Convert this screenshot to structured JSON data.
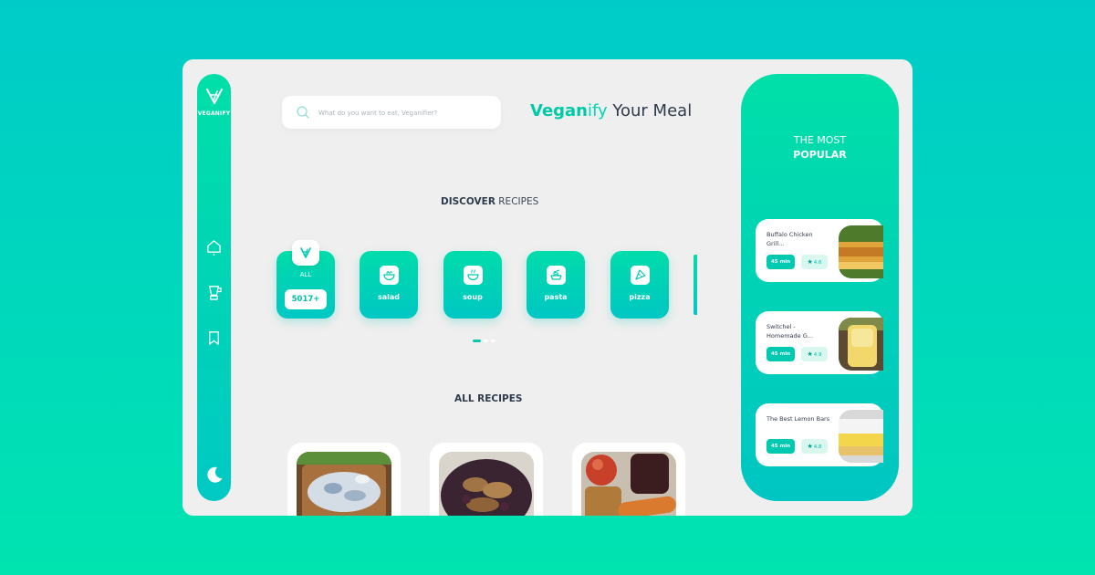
{
  "brand": {
    "name": "VEGANIFY"
  },
  "colors": {
    "accent": "#00c9b2",
    "accent_green": "#00dfa8",
    "text_dark": "#2f3b4b",
    "window_bg": "#efefef"
  },
  "sidebar": {
    "icons": [
      "home-icon",
      "blender-icon",
      "bookmark-icon",
      "moon-icon"
    ]
  },
  "search": {
    "placeholder": "What do you want to eat, Veganifier?"
  },
  "headline": {
    "part1": "Vegan",
    "part2": "ify",
    "part3": " Your Meal"
  },
  "discover": {
    "bold": "DISCOVER",
    "light": " RECIPES"
  },
  "categories": {
    "all": {
      "label": "ALL",
      "count": "5017+"
    },
    "items": [
      {
        "label": "salad",
        "icon": "salad-icon"
      },
      {
        "label": "soup",
        "icon": "soup-icon"
      },
      {
        "label": "pasta",
        "icon": "pasta-icon"
      },
      {
        "label": "pizza",
        "icon": "pizza-icon"
      }
    ]
  },
  "all_recipes": {
    "title": "ALL RECIPES"
  },
  "popular": {
    "title": "THE MOST",
    "subtitle": "POPULAR",
    "items": [
      {
        "name": "Buffalo Chicken Grill...",
        "time": "45 min",
        "rating": "4.6"
      },
      {
        "name": "Switchel - Homemade G...",
        "time": "45 min",
        "rating": "4.9"
      },
      {
        "name": "The Best Lemon Bars",
        "time": "45 min",
        "rating": "4.8"
      }
    ]
  }
}
